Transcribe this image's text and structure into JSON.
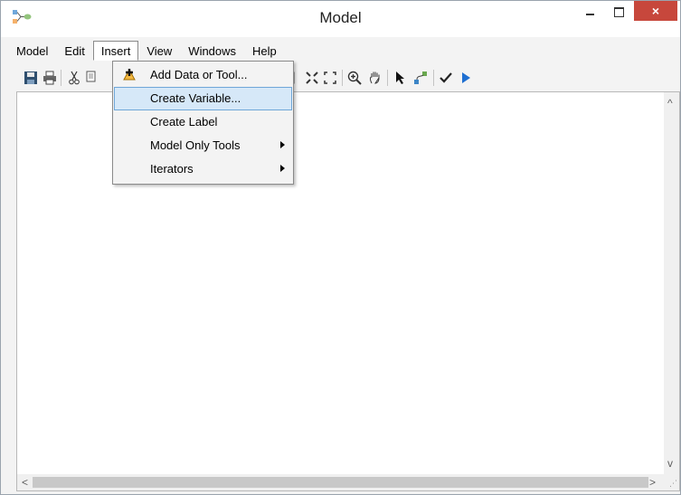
{
  "window": {
    "title": "Model",
    "close_glyph": "×"
  },
  "menubar": {
    "items": [
      {
        "label": "Model"
      },
      {
        "label": "Edit"
      },
      {
        "label": "Insert"
      },
      {
        "label": "View"
      },
      {
        "label": "Windows"
      },
      {
        "label": "Help"
      }
    ],
    "open_menu": "Insert"
  },
  "insert_menu": {
    "items": [
      {
        "label": "Add Data or Tool...",
        "icon": "add-data-icon"
      },
      {
        "label": "Create Variable...",
        "highlighted": true
      },
      {
        "label": "Create Label"
      },
      {
        "label": "Model Only Tools",
        "submenu": true
      },
      {
        "label": "Iterators",
        "submenu": true
      }
    ]
  },
  "toolbar": {
    "icons": [
      "save-icon",
      "print-icon",
      "cut-icon",
      "copy-icon",
      "paste-icon",
      "full-extent-icon",
      "fit-to-window-icon",
      "zoom-in-icon",
      "pan-icon",
      "select-icon",
      "connect-icon",
      "validate-icon",
      "run-icon"
    ]
  },
  "scrollbars": {
    "up_arrow": "^",
    "down_arrow": "v",
    "left_arrow": "<",
    "right_arrow": ">"
  },
  "colors": {
    "close_button": "#c7473c",
    "menu_highlight": "#d6e8f8",
    "menu_highlight_border": "#6fa7d8"
  }
}
